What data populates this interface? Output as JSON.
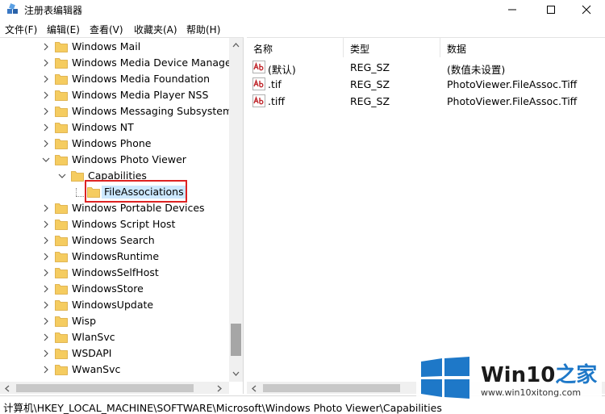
{
  "window": {
    "title": "注册表编辑器",
    "controls": [
      "minimize",
      "maximize",
      "close"
    ]
  },
  "menu": [
    {
      "label": "文件(F)"
    },
    {
      "label": "编辑(E)"
    },
    {
      "label": "查看(V)"
    },
    {
      "label": "收藏夹(A)"
    },
    {
      "label": "帮助(H)"
    }
  ],
  "tree": {
    "items": [
      {
        "label": "Windows Mail",
        "level": 0,
        "expander": "collapsed"
      },
      {
        "label": "Windows Media Device Manager",
        "level": 0,
        "expander": "collapsed"
      },
      {
        "label": "Windows Media Foundation",
        "level": 0,
        "expander": "collapsed"
      },
      {
        "label": "Windows Media Player NSS",
        "level": 0,
        "expander": "collapsed"
      },
      {
        "label": "Windows Messaging Subsystem",
        "level": 0,
        "expander": "collapsed"
      },
      {
        "label": "Windows NT",
        "level": 0,
        "expander": "collapsed"
      },
      {
        "label": "Windows Phone",
        "level": 0,
        "expander": "collapsed"
      },
      {
        "label": "Windows Photo Viewer",
        "level": 0,
        "expander": "expanded"
      },
      {
        "label": "Capabilities",
        "level": 1,
        "expander": "expanded"
      },
      {
        "label": "FileAssociations",
        "level": 2,
        "expander": "none",
        "selected": true
      },
      {
        "label": "Windows Portable Devices",
        "level": 0,
        "expander": "collapsed"
      },
      {
        "label": "Windows Script Host",
        "level": 0,
        "expander": "collapsed"
      },
      {
        "label": "Windows Search",
        "level": 0,
        "expander": "collapsed"
      },
      {
        "label": "WindowsRuntime",
        "level": 0,
        "expander": "collapsed"
      },
      {
        "label": "WindowsSelfHost",
        "level": 0,
        "expander": "collapsed"
      },
      {
        "label": "WindowsStore",
        "level": 0,
        "expander": "collapsed"
      },
      {
        "label": "WindowsUpdate",
        "level": 0,
        "expander": "collapsed"
      },
      {
        "label": "Wisp",
        "level": 0,
        "expander": "collapsed"
      },
      {
        "label": "WlanSvc",
        "level": 0,
        "expander": "collapsed"
      },
      {
        "label": "WSDAPI",
        "level": 0,
        "expander": "collapsed"
      },
      {
        "label": "WwanSvc",
        "level": 0,
        "expander": "collapsed"
      }
    ]
  },
  "list": {
    "columns": [
      "名称",
      "类型",
      "数据"
    ],
    "rows": [
      {
        "name": "(默认)",
        "type": "REG_SZ",
        "data": "(数值未设置)"
      },
      {
        "name": ".tif",
        "type": "REG_SZ",
        "data": "PhotoViewer.FileAssoc.Tiff"
      },
      {
        "name": ".tiff",
        "type": "REG_SZ",
        "data": "PhotoViewer.FileAssoc.Tiff"
      }
    ],
    "value_icon": "ab-string-icon"
  },
  "status": {
    "path": "计算机\\HKEY_LOCAL_MACHINE\\SOFTWARE\\Microsoft\\Windows Photo Viewer\\Capabilities"
  },
  "watermark": {
    "brand_main": "Win10",
    "brand_accent": "之家",
    "url": "www.win10xitong.com"
  },
  "colors": {
    "selection": "#cce8ff",
    "highlight_border": "#dd2222",
    "folder": "#f5cc60",
    "brand_blue": "#1e78c8"
  }
}
